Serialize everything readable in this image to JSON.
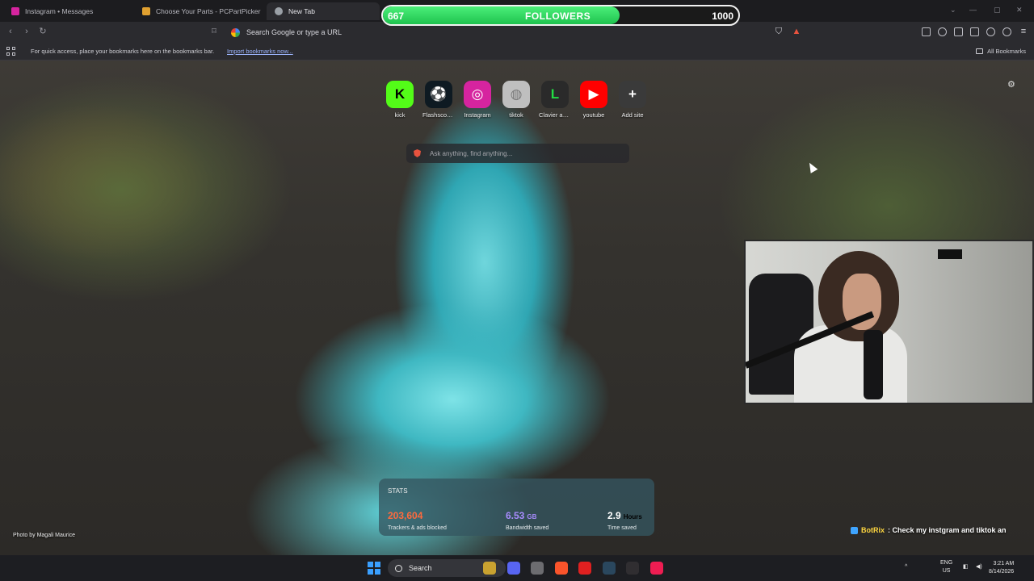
{
  "tabs": [
    {
      "title": "Instagram • Messages",
      "favicon_color": "#d6249f",
      "active": false
    },
    {
      "title": "Choose Your Parts - PCPartPicker",
      "favicon_color": "#e0a030",
      "active": false
    },
    {
      "title": "New Tab",
      "favicon_color": "#9aa0a6",
      "active": true
    }
  ],
  "omnibox": {
    "placeholder": "Search Google or type a URL"
  },
  "bookmarks_bar": {
    "message": "For quick access, place your bookmarks here on the bookmarks bar.",
    "import_link": "Import bookmarks now...",
    "all_bookmarks": "All Bookmarks"
  },
  "speed_dial": [
    {
      "label": "kick",
      "letter": "K",
      "color": "#53fc18",
      "text_color": "#000000"
    },
    {
      "label": "Flashscore...",
      "letter": "⚽",
      "color": "#0e1a22",
      "text_color": "#ff2a5a"
    },
    {
      "label": "Instagram",
      "letter": "◎",
      "color": "#d6249f",
      "text_color": "#ffffff"
    },
    {
      "label": "tiktok",
      "letter": "◍",
      "color": "#bfbfbf",
      "text_color": "#7a7a7a"
    },
    {
      "label": "Clavier am...",
      "letter": "L",
      "color": "#2a2a2a",
      "text_color": "#22dd44"
    },
    {
      "label": "youtube",
      "letter": "▶",
      "color": "#ff0000",
      "text_color": "#ffffff"
    },
    {
      "label": "Add site",
      "letter": "+",
      "color": "#3a3a3a",
      "text_color": "#ffffff"
    }
  ],
  "ask_box": {
    "placeholder": "Ask anything, find anything..."
  },
  "stats": {
    "title": "STATS",
    "items": [
      {
        "value": "203,604",
        "unit": "",
        "label": "Trackers & ads blocked",
        "color": "#ff6a3d"
      },
      {
        "value": "6.53",
        "unit": "GB",
        "label": "Bandwidth saved",
        "color": "#a98cff"
      },
      {
        "value": "2.9",
        "unit": "Hours",
        "label": "Time saved",
        "color": "#ffffff"
      }
    ]
  },
  "photo_credit": "Photo by Magali Maurice",
  "follower_goal": {
    "current": "667",
    "label": "FOLLOWERS",
    "target": "1000",
    "progress_fraction": 0.667
  },
  "chat_overlay": {
    "user": "BotRix",
    "message": ": Check my instgram and tiktok an"
  },
  "taskbar": {
    "search_label": "Search",
    "apps": [
      {
        "name": "file-app",
        "color": "#c9a230"
      },
      {
        "name": "discord-app",
        "color": "#5865f2"
      },
      {
        "name": "settings-app",
        "color": "#6c6c70"
      },
      {
        "name": "brave-app",
        "color": "#fb542b"
      },
      {
        "name": "acrobat-app",
        "color": "#e02020"
      },
      {
        "name": "steam-app",
        "color": "#2a475e"
      },
      {
        "name": "obs-app",
        "color": "#302e31"
      },
      {
        "name": "tiktok-app",
        "color": "#ee1d52"
      }
    ],
    "language": "ENG",
    "region": "US",
    "time": "3:21 AM",
    "date": "8/14/2026"
  }
}
